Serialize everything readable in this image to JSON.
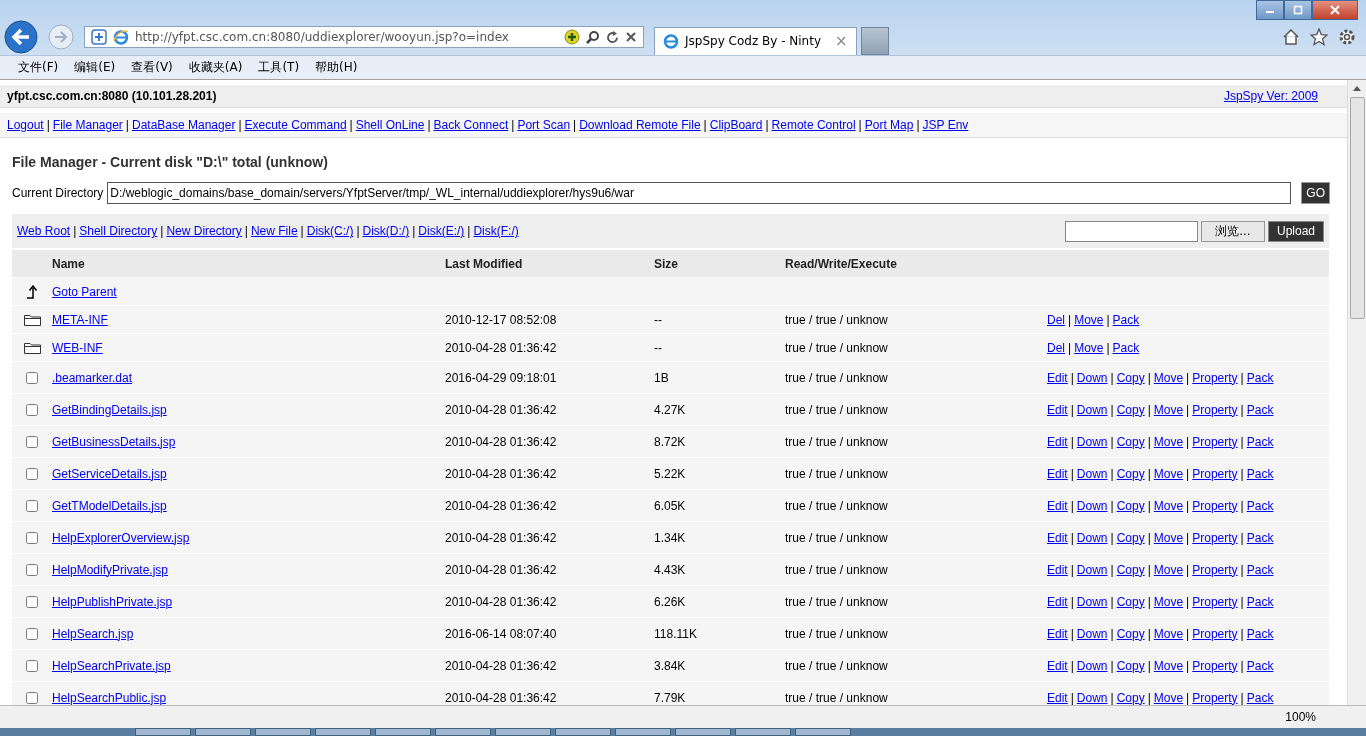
{
  "browser": {
    "address": "http://yfpt.csc.com.cn:8080/uddiexplorer/wooyun.jsp?o=index",
    "tabs": [
      {
        "title": "JspSpy Codz By - Ninty",
        "close": "×",
        "selected": true
      }
    ],
    "menu": [
      "文件(F)",
      "编辑(E)",
      "查看(V)",
      "收藏夹(A)",
      "工具(T)",
      "帮助(H)"
    ]
  },
  "page": {
    "separator": "|",
    "host": "yfpt.csc.com.cn:8080 (10.101.28.201)",
    "version_link": "JspSpy Ver: 2009",
    "nav_links": [
      "Logout",
      "File Manager",
      "DataBase Manager",
      "Execute Command",
      "Shell OnLine",
      "Back Connect",
      "Port Scan",
      "Download Remote File",
      "ClipBoard",
      "Remote Control",
      "Port Map",
      "JSP Env"
    ],
    "heading": "File Manager - Current disk \"D:\\\" total (unknow)",
    "current_directory": {
      "label": "Current Directory",
      "value": "D:/weblogic_domains/base_domain/servers/YfptServer/tmp/_WL_internal/uddiexplorer/hys9u6/war",
      "button": "GO"
    },
    "shortcuts": [
      "Web Root",
      "Shell Directory",
      "New Directory",
      "New File",
      "Disk(C:/)",
      "Disk(D:/)",
      "Disk(E:/)",
      "Disk(F:/)"
    ],
    "upload": {
      "browse_button": "浏览...",
      "button": "Upload"
    },
    "table": {
      "columns": [
        "Name",
        "Last Modified",
        "Size",
        "Read/Write/Execute"
      ],
      "rows": [
        {
          "kind": "parent",
          "name": "Goto Parent"
        },
        {
          "kind": "dir",
          "name": "META-INF",
          "modified": "2010-12-17 08:52:08",
          "size": "--",
          "rwx": "true / true / unknow",
          "actions": [
            "Del",
            "Move",
            "Pack"
          ]
        },
        {
          "kind": "dir",
          "name": "WEB-INF",
          "modified": "2010-04-28 01:36:42",
          "size": "--",
          "rwx": "true / true / unknow",
          "actions": [
            "Del",
            "Move",
            "Pack"
          ]
        },
        {
          "kind": "file",
          "checked": false,
          "name": ".beamarker.dat",
          "modified": "2016-04-29 09:18:01",
          "size": "1B",
          "rwx": "true / true / unknow",
          "actions": [
            "Edit",
            "Down",
            "Copy",
            "Move",
            "Property",
            "Pack"
          ]
        },
        {
          "kind": "file",
          "checked": false,
          "name": "GetBindingDetails.jsp",
          "modified": "2010-04-28 01:36:42",
          "size": "4.27K",
          "rwx": "true / true / unknow",
          "actions": [
            "Edit",
            "Down",
            "Copy",
            "Move",
            "Property",
            "Pack"
          ]
        },
        {
          "kind": "file",
          "checked": false,
          "name": "GetBusinessDetails.jsp",
          "modified": "2010-04-28 01:36:42",
          "size": "8.72K",
          "rwx": "true / true / unknow",
          "actions": [
            "Edit",
            "Down",
            "Copy",
            "Move",
            "Property",
            "Pack"
          ]
        },
        {
          "kind": "file",
          "checked": false,
          "name": "GetServiceDetails.jsp",
          "modified": "2010-04-28 01:36:42",
          "size": "5.22K",
          "rwx": "true / true / unknow",
          "actions": [
            "Edit",
            "Down",
            "Copy",
            "Move",
            "Property",
            "Pack"
          ]
        },
        {
          "kind": "file",
          "checked": false,
          "name": "GetTModelDetails.jsp",
          "modified": "2010-04-28 01:36:42",
          "size": "6.05K",
          "rwx": "true / true / unknow",
          "actions": [
            "Edit",
            "Down",
            "Copy",
            "Move",
            "Property",
            "Pack"
          ]
        },
        {
          "kind": "file",
          "checked": false,
          "name": "HelpExplorerOverview.jsp",
          "modified": "2010-04-28 01:36:42",
          "size": "1.34K",
          "rwx": "true / true / unknow",
          "actions": [
            "Edit",
            "Down",
            "Copy",
            "Move",
            "Property",
            "Pack"
          ]
        },
        {
          "kind": "file",
          "checked": false,
          "name": "HelpModifyPrivate.jsp",
          "modified": "2010-04-28 01:36:42",
          "size": "4.43K",
          "rwx": "true / true / unknow",
          "actions": [
            "Edit",
            "Down",
            "Copy",
            "Move",
            "Property",
            "Pack"
          ]
        },
        {
          "kind": "file",
          "checked": false,
          "name": "HelpPublishPrivate.jsp",
          "modified": "2010-04-28 01:36:42",
          "size": "6.26K",
          "rwx": "true / true / unknow",
          "actions": [
            "Edit",
            "Down",
            "Copy",
            "Move",
            "Property",
            "Pack"
          ]
        },
        {
          "kind": "file",
          "checked": false,
          "name": "HelpSearch.jsp",
          "modified": "2016-06-14 08:07:40",
          "size": "118.11K",
          "rwx": "true / true / unknow",
          "actions": [
            "Edit",
            "Down",
            "Copy",
            "Move",
            "Property",
            "Pack"
          ]
        },
        {
          "kind": "file",
          "checked": false,
          "name": "HelpSearchPrivate.jsp",
          "modified": "2010-04-28 01:36:42",
          "size": "3.84K",
          "rwx": "true / true / unknow",
          "actions": [
            "Edit",
            "Down",
            "Copy",
            "Move",
            "Property",
            "Pack"
          ]
        },
        {
          "kind": "file",
          "checked": false,
          "name": "HelpSearchPublic.jsp",
          "modified": "2010-04-28 01:36:42",
          "size": "7.79K",
          "rwx": "true / true / unknow",
          "actions": [
            "Edit",
            "Down",
            "Copy",
            "Move",
            "Property",
            "Pack"
          ]
        }
      ]
    }
  },
  "status_bar": {
    "zoom": "100%"
  }
}
